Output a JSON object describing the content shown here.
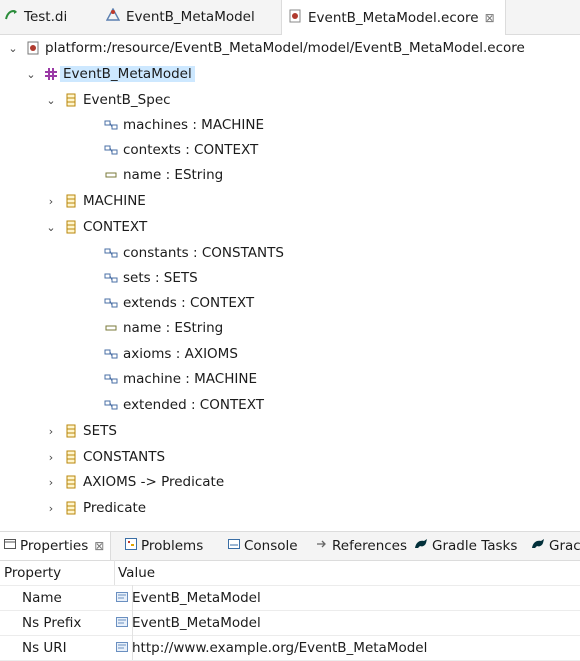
{
  "editor_tabs": [
    {
      "label": "Test.di",
      "icon": "diagram-icon",
      "active": false
    },
    {
      "label": "EventB_MetaModel",
      "icon": "model-icon",
      "active": false
    },
    {
      "label": "EventB_MetaModel.ecore",
      "icon": "ecore-file-icon",
      "active": true
    }
  ],
  "close_glyph": "⊠",
  "tree": {
    "root": "platform:/resource/EventB_MetaModel/model/EventB_MetaModel.ecore",
    "package": "EventB_MetaModel",
    "nodes": [
      {
        "label": "EventB_Spec"
      },
      {
        "label": "machines : MACHINE"
      },
      {
        "label": "contexts : CONTEXT"
      },
      {
        "label": "name : EString"
      },
      {
        "label": "MACHINE"
      },
      {
        "label": "CONTEXT"
      },
      {
        "label": "constants : CONSTANTS"
      },
      {
        "label": "sets : SETS"
      },
      {
        "label": "extends : CONTEXT"
      },
      {
        "label": "name : EString"
      },
      {
        "label": "axioms : AXIOMS"
      },
      {
        "label": "machine : MACHINE"
      },
      {
        "label": "extended : CONTEXT"
      },
      {
        "label": "SETS"
      },
      {
        "label": "CONSTANTS"
      },
      {
        "label": "AXIOMS -> Predicate"
      },
      {
        "label": "Predicate"
      }
    ]
  },
  "bottom_tabs": [
    {
      "label": "Properties",
      "icon": "properties-icon"
    },
    {
      "label": "Problems",
      "icon": "problems-icon"
    },
    {
      "label": "Console",
      "icon": "console-icon"
    },
    {
      "label": "References",
      "icon": "references-icon"
    },
    {
      "label": "Gradle Tasks",
      "icon": "gradle-icon"
    },
    {
      "label": "Grac",
      "icon": "gradle-icon"
    }
  ],
  "properties": {
    "header": {
      "property": "Property",
      "value": "Value"
    },
    "rows": [
      {
        "key": "Name",
        "value": "EventB_MetaModel"
      },
      {
        "key": "Ns Prefix",
        "value": "EventB_MetaModel"
      },
      {
        "key": "Ns URI",
        "value": "http://www.example.org/EventB_MetaModel"
      }
    ]
  },
  "colors": {
    "selection": "#cde8ff",
    "class_icon": "#b8860b",
    "package_icon": "#9b3aa6"
  }
}
